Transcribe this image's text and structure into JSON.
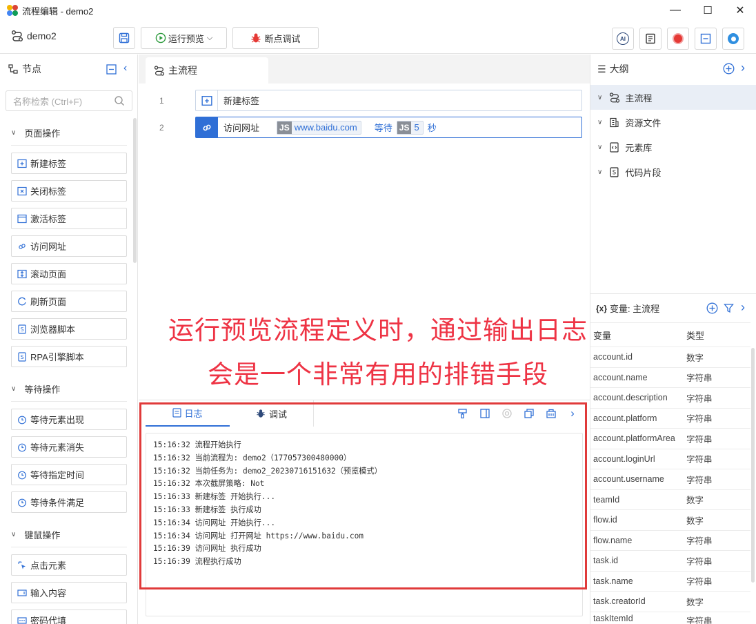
{
  "window": {
    "title": "流程编辑 - demo2",
    "minimize": "—",
    "maximize": "☐",
    "close": "✕"
  },
  "toolbar": {
    "project_name": "demo2",
    "save_label": "",
    "run_preview_label": "运行预览",
    "debug_label": "断点调试",
    "ai_label": "AI"
  },
  "left_panel": {
    "title": "节点",
    "search_placeholder": "名称检索 (Ctrl+F)",
    "groups": [
      {
        "name": "页面操作",
        "items": [
          "新建标签",
          "关闭标签",
          "激活标签",
          "访问网址",
          "滚动页面",
          "刷新页面",
          "浏览器脚本",
          "RPA引擎脚本"
        ]
      },
      {
        "name": "等待操作",
        "items": [
          "等待元素出现",
          "等待元素消失",
          "等待指定时间",
          "等待条件满足"
        ]
      },
      {
        "name": "键鼠操作",
        "items": [
          "点击元素",
          "输入内容",
          "密码代填"
        ]
      }
    ]
  },
  "editor": {
    "tab_label": "主流程",
    "steps": [
      {
        "line": "1",
        "label": "新建标签"
      },
      {
        "line": "2",
        "label": "访问网址",
        "url_chip": "www.baidu.com",
        "js_tag": "JS",
        "wait_label": "等待",
        "wait_value": "5",
        "wait_unit": "秒"
      }
    ]
  },
  "overlay": {
    "line1": "运行预览流程定义时，通过输出日志",
    "line2": "会是一个非常有用的排错手段"
  },
  "log_panel": {
    "tab_log": "日志",
    "tab_debug": "调试",
    "lines": [
      "15:16:32 流程开始执行",
      "15:16:32 当前流程为: demo2（177057300480000）",
      "15:16:32 当前任务为: demo2_20230716151632（预览模式）",
      "15:16:32 本次截屏策略: Not",
      "15:16:33 新建标签 开始执行...",
      "15:16:33 新建标签 执行成功",
      "15:16:34 访问网址 开始执行...",
      "15:16:34 访问网址 打开网址 https://www.baidu.com",
      "15:16:39 访问网址 执行成功",
      "15:16:39 流程执行成功"
    ]
  },
  "right_panel": {
    "outline_title": "大纲",
    "outline_items": [
      "主流程",
      "资源文件",
      "元素库",
      "代码片段"
    ],
    "vars_title": "变量: 主流程",
    "vars_icon_text": "{x}",
    "col_var": "变量",
    "col_type": "类型",
    "vars": [
      {
        "name": "account.id",
        "type": "数字"
      },
      {
        "name": "account.name",
        "type": "字符串"
      },
      {
        "name": "account.description",
        "type": "字符串"
      },
      {
        "name": "account.platform",
        "type": "字符串"
      },
      {
        "name": "account.platformArea",
        "type": "字符串"
      },
      {
        "name": "account.loginUrl",
        "type": "字符串"
      },
      {
        "name": "account.username",
        "type": "字符串"
      },
      {
        "name": "teamId",
        "type": "数字"
      },
      {
        "name": "flow.id",
        "type": "数字"
      },
      {
        "name": "flow.name",
        "type": "字符串"
      },
      {
        "name": "task.id",
        "type": "字符串"
      },
      {
        "name": "task.name",
        "type": "字符串"
      },
      {
        "name": "task.creatorId",
        "type": "数字"
      },
      {
        "name": "taskItemId",
        "type": "字符串"
      }
    ]
  },
  "colors": {
    "accent": "#2f6fd6",
    "record_red": "#e53935",
    "overlay_red": "#ee3344",
    "frame_red": "#e03a3a"
  }
}
